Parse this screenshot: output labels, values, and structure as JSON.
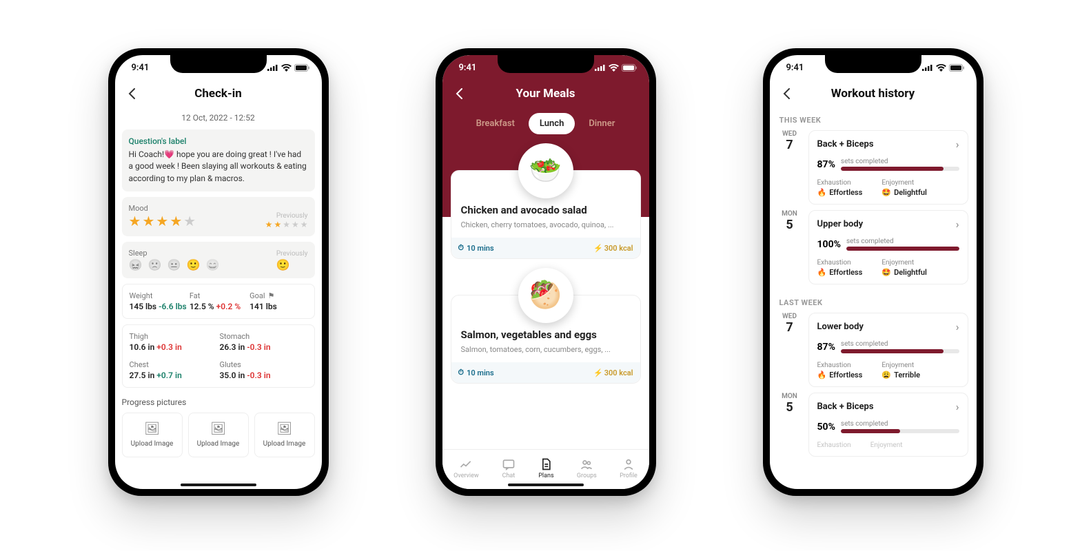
{
  "common": {
    "time": "9:41"
  },
  "phone1": {
    "title": "Check-in",
    "timestamp": "12 Oct, 2022 - 12:52",
    "question_label": "Question's label",
    "question_text": "Hi Coach!💗 hope you are doing great ! I've had a good week ! Been slaying all workouts & eating according to my plan & macros.",
    "mood_label": "Mood",
    "previously": "Previously",
    "sleep_label": "Sleep",
    "mood_stars": 4,
    "mood_prev_stars": 2,
    "metrics1": {
      "weight_lbl": "Weight",
      "weight_val": "145 lbs",
      "weight_delta": "-6.6 lbs",
      "fat_lbl": "Fat",
      "fat_val": "12.5 %",
      "fat_delta": "+0.2 %",
      "goal_lbl": "Goal",
      "goal_val": "141 lbs"
    },
    "metrics2": {
      "thigh_lbl": "Thigh",
      "thigh_val": "10.6 in",
      "thigh_delta": "+0.3 in",
      "stomach_lbl": "Stomach",
      "stomach_val": "26.3 in",
      "stomach_delta": "-0.3 in",
      "chest_lbl": "Chest",
      "chest_val": "27.5 in",
      "chest_delta": "+0.7 in",
      "glutes_lbl": "Glutes",
      "glutes_val": "35.0 in",
      "glutes_delta": "-0.3 in"
    },
    "progress_lbl": "Progress pictures",
    "upload": "Upload Image"
  },
  "phone2": {
    "title": "Your Meals",
    "tabs": {
      "breakfast": "Breakfast",
      "lunch": "Lunch",
      "dinner": "Dinner"
    },
    "meals": [
      {
        "title": "Chicken and avocado salad",
        "sub": "Chicken, cherry tomatoes, avocado, quinoa, ...",
        "time": "10 mins",
        "kcal": "300 kcal",
        "icon": "🥗"
      },
      {
        "title": "Salmon, vegetables and eggs",
        "sub": "Salmon, tomatoes, corn, cucumbers, eggs, ...",
        "time": "10 mins",
        "kcal": "300 kcal",
        "icon": "🥙"
      }
    ],
    "tabbar": {
      "overview": "Overview",
      "chat": "Chat",
      "plans": "Plans",
      "groups": "Groups",
      "profile": "Profile"
    }
  },
  "phone3": {
    "title": "Workout history",
    "this_week": "THIS WEEK",
    "last_week": "LAST WEEK",
    "sets_completed": "sets completed",
    "exhaustion": "Exhaustion",
    "enjoyment": "Enjoyment",
    "effortless": "Effortless",
    "delightful": "Delightful",
    "terrible": "Terrible",
    "workouts": [
      {
        "dayw": "WED",
        "dayn": "7",
        "name": "Back + Biceps",
        "pct": "87%",
        "pctv": 87,
        "exh": "Effortless",
        "enj": "Delightful",
        "enj_icon": "🤩"
      },
      {
        "dayw": "MON",
        "dayn": "5",
        "name": "Upper body",
        "pct": "100%",
        "pctv": 100,
        "exh": "Effortless",
        "enj": "Delightful",
        "enj_icon": "🤩"
      },
      {
        "dayw": "WED",
        "dayn": "7",
        "name": "Lower body",
        "pct": "87%",
        "pctv": 87,
        "exh": "Effortless",
        "enj": "Terrible",
        "enj_icon": "😩"
      },
      {
        "dayw": "MON",
        "dayn": "5",
        "name": "Back + Biceps",
        "pct": "50%",
        "pctv": 50,
        "exh": "Exhaustion",
        "enj": "Enjoyment",
        "enj_icon": ""
      }
    ]
  }
}
